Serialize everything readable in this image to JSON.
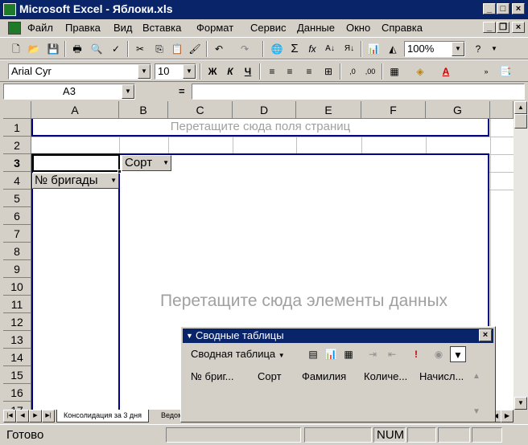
{
  "window": {
    "title": "Microsoft Excel - Яблоки.xls",
    "min": "_",
    "max": "□",
    "close": "×"
  },
  "menu": [
    "Файл",
    "Правка",
    "Вид",
    "Вставка",
    "Формат",
    "Сервис",
    "Данные",
    "Окно",
    "Справка"
  ],
  "toolbar": {
    "zoom": "100%",
    "font_name": "Arial Cyr",
    "font_size": "10",
    "bold": "Ж",
    "italic": "К",
    "underline": "Ч"
  },
  "formula": {
    "name_box": "A3",
    "equals": "=",
    "value": ""
  },
  "sheet": {
    "columns": [
      "A",
      "B",
      "C",
      "D",
      "E",
      "F",
      "G"
    ],
    "rows": [
      "1",
      "2",
      "3",
      "4",
      "5",
      "6",
      "7",
      "8",
      "9",
      "10",
      "11",
      "12",
      "13",
      "14",
      "15",
      "16",
      "17"
    ],
    "page_drop": "Перетащите сюда поля страниц",
    "data_drop": "Перетащите сюда элементы данных",
    "col_field": "Сорт",
    "row_field": "№ бригады",
    "active_cell": "A3"
  },
  "tabs": [
    "Консолидация за 3 дня",
    "Ведом"
  ],
  "status": {
    "ready": "Готово",
    "num": "NUM"
  },
  "pivot_toolbar": {
    "title": "Сводные таблицы",
    "menu_label": "Сводная таблица",
    "fields": [
      "№ бриг...",
      "Сорт",
      "Фамилия",
      "Количе...",
      "Начисл..."
    ]
  }
}
